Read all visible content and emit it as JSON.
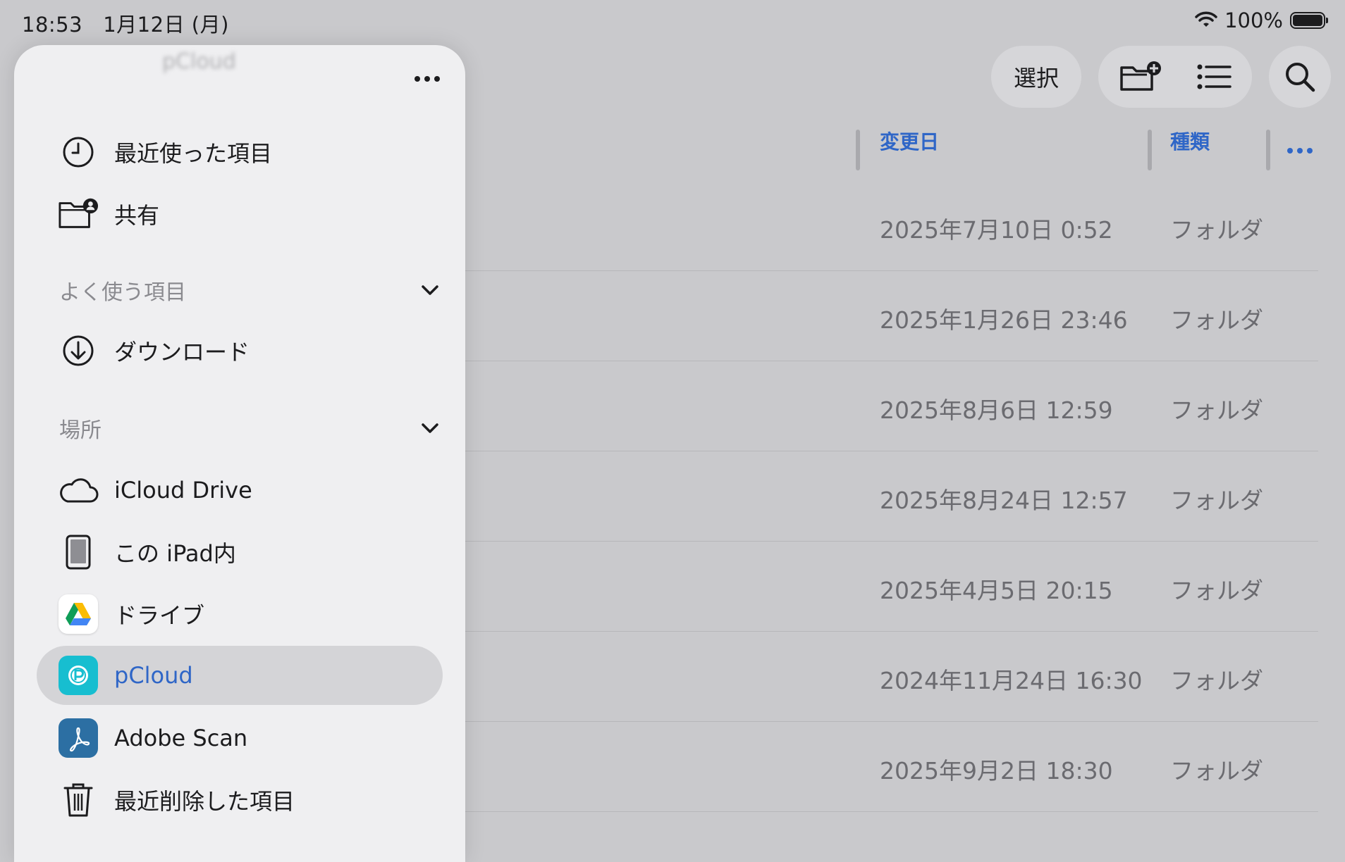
{
  "status_bar": {
    "time": "18:53",
    "date": "1月12日 (月)",
    "battery": "100%"
  },
  "toolbar": {
    "select_label": "選択",
    "icons": [
      "new-folder-icon",
      "list-view-icon",
      "search-icon"
    ]
  },
  "columns": {
    "modified": "変更日",
    "kind": "種類"
  },
  "rows": [
    {
      "date": "2025年7月10日 0:52",
      "kind": "フォルダ"
    },
    {
      "date": "2025年1月26日 23:46",
      "kind": "フォルダ"
    },
    {
      "date": "2025年8月6日 12:59",
      "kind": "フォルダ"
    },
    {
      "date": "2025年8月24日 12:57",
      "kind": "フォルダ"
    },
    {
      "date": "2025年4月5日 20:15",
      "kind": "フォルダ"
    },
    {
      "date": "2024年11月24日 16:30",
      "kind": "フォルダ"
    },
    {
      "date": "2025年9月2日 18:30",
      "kind": "フォルダ"
    }
  ],
  "sidebar": {
    "top_items": [
      {
        "label": "最近使った項目",
        "icon": "clock-icon"
      },
      {
        "label": "共有",
        "icon": "shared-folder-icon"
      }
    ],
    "favorites": {
      "title": "よく使う項目",
      "items": [
        {
          "label": "ダウンロード",
          "icon": "download-icon"
        }
      ]
    },
    "locations": {
      "title": "場所",
      "items": [
        {
          "label": "iCloud Drive",
          "icon": "cloud-icon"
        },
        {
          "label": "この iPad内",
          "icon": "ipad-icon"
        },
        {
          "label": "ドライブ",
          "icon": "google-drive-icon"
        },
        {
          "label": "pCloud",
          "icon": "pcloud-icon",
          "selected": true
        },
        {
          "label": "Adobe Scan",
          "icon": "adobe-scan-icon"
        },
        {
          "label": "最近削除した項目",
          "icon": "trash-icon"
        }
      ]
    }
  },
  "colors": {
    "accent": "#2f66c7",
    "background": "#c9c9cc",
    "sidebar": "#efeff1"
  }
}
